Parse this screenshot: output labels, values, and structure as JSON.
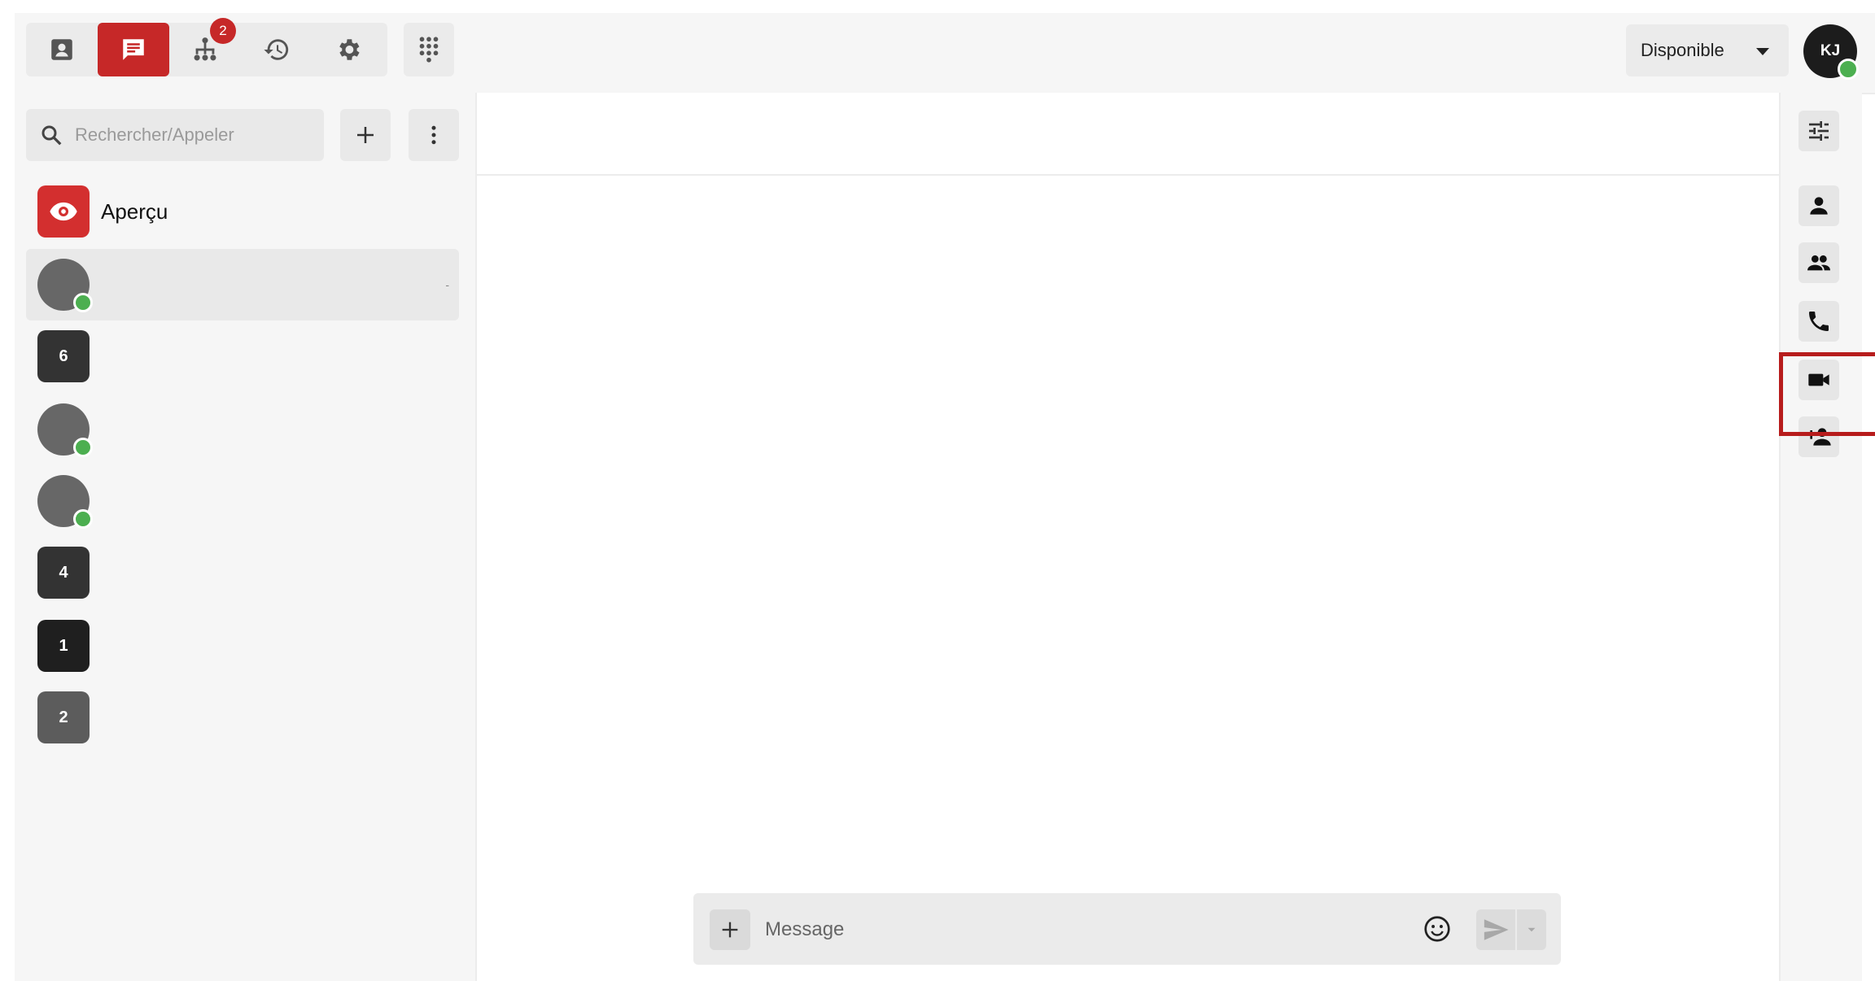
{
  "topbar": {
    "nav": [
      {
        "name": "contacts",
        "icon": "contact-card-icon"
      },
      {
        "name": "messages",
        "icon": "chat-icon",
        "active": true
      },
      {
        "name": "organization",
        "icon": "org-chart-icon",
        "badge": "2"
      },
      {
        "name": "history",
        "icon": "history-icon"
      },
      {
        "name": "settings",
        "icon": "gear-icon"
      }
    ],
    "dialpad_icon": "dialpad-icon",
    "status": "Disponible",
    "user_initials": "KJ"
  },
  "sidebar": {
    "search_placeholder": "Rechercher/Appeler",
    "apercu_label": "Aperçu",
    "selected_dash": "-",
    "conversations": [
      {
        "type": "person"
      },
      {
        "type": "group",
        "count": "6"
      },
      {
        "type": "person"
      },
      {
        "type": "person"
      },
      {
        "type": "group",
        "count": "4"
      },
      {
        "type": "group",
        "count": "1"
      },
      {
        "type": "group",
        "count": "2"
      }
    ]
  },
  "composer": {
    "placeholder": "Message"
  },
  "rightrail": {
    "buttons": [
      "filter-icon",
      "person-icon",
      "group-icon",
      "phone-icon",
      "video-camera-icon",
      "add-person-icon"
    ],
    "highlighted": "video-camera-icon"
  },
  "colors": {
    "accent": "#c62828",
    "online": "#4caf50",
    "highlight": "#b71c1c"
  }
}
